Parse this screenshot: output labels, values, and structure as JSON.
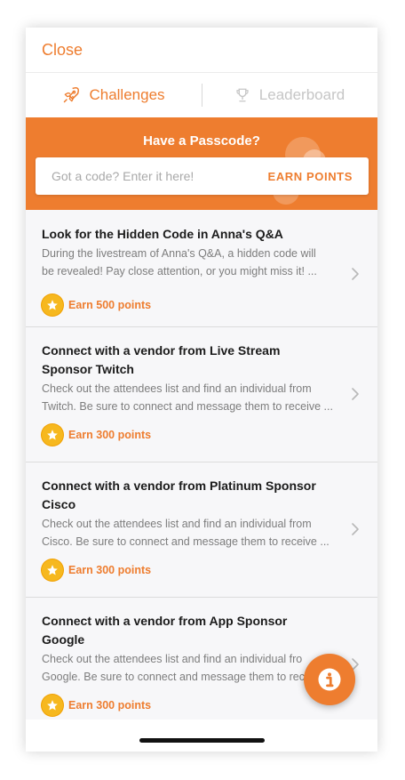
{
  "header": {
    "close_label": "Close"
  },
  "tabs": [
    {
      "label": "Challenges",
      "icon": "rocket-icon",
      "active": true
    },
    {
      "label": "Leaderboard",
      "icon": "trophy-icon",
      "active": false
    }
  ],
  "passcode": {
    "title": "Have a Passcode?",
    "placeholder": "Got a code? Enter it here!",
    "action_label": "EARN POINTS"
  },
  "challenges": [
    {
      "title_lines": [
        "Look for the Hidden Code in Anna's Q&A"
      ],
      "desc_lines": [
        "During the livestream of Anna's Q&A, a hidden code will",
        "be revealed! Pay close attention, or you might miss it! ..."
      ],
      "reward": "Earn 500 points"
    },
    {
      "title_lines": [
        "Connect with a vendor from Live Stream",
        "Sponsor Twitch"
      ],
      "desc_lines": [
        "Check out the attendees list and find an individual from",
        "Twitch. Be sure to connect and message them to receive ..."
      ],
      "reward": "Earn 300 points"
    },
    {
      "title_lines": [
        "Connect with a vendor from Platinum Sponsor",
        "Cisco"
      ],
      "desc_lines": [
        "Check out the attendees list and find an individual from",
        "Cisco. Be sure to connect and message them to receive ..."
      ],
      "reward": "Earn 300 points"
    },
    {
      "title_lines": [
        "Connect with a vendor from App Sponsor",
        "Google"
      ],
      "desc_lines": [
        "Check out the attendees list and find an individual fro",
        "Google. Be sure to connect and message them to rec"
      ],
      "reward": "Earn 300 points"
    }
  ],
  "colors": {
    "accent": "#ee7d2f",
    "star": "#f6b81f"
  },
  "fab": {
    "icon": "info-icon"
  }
}
